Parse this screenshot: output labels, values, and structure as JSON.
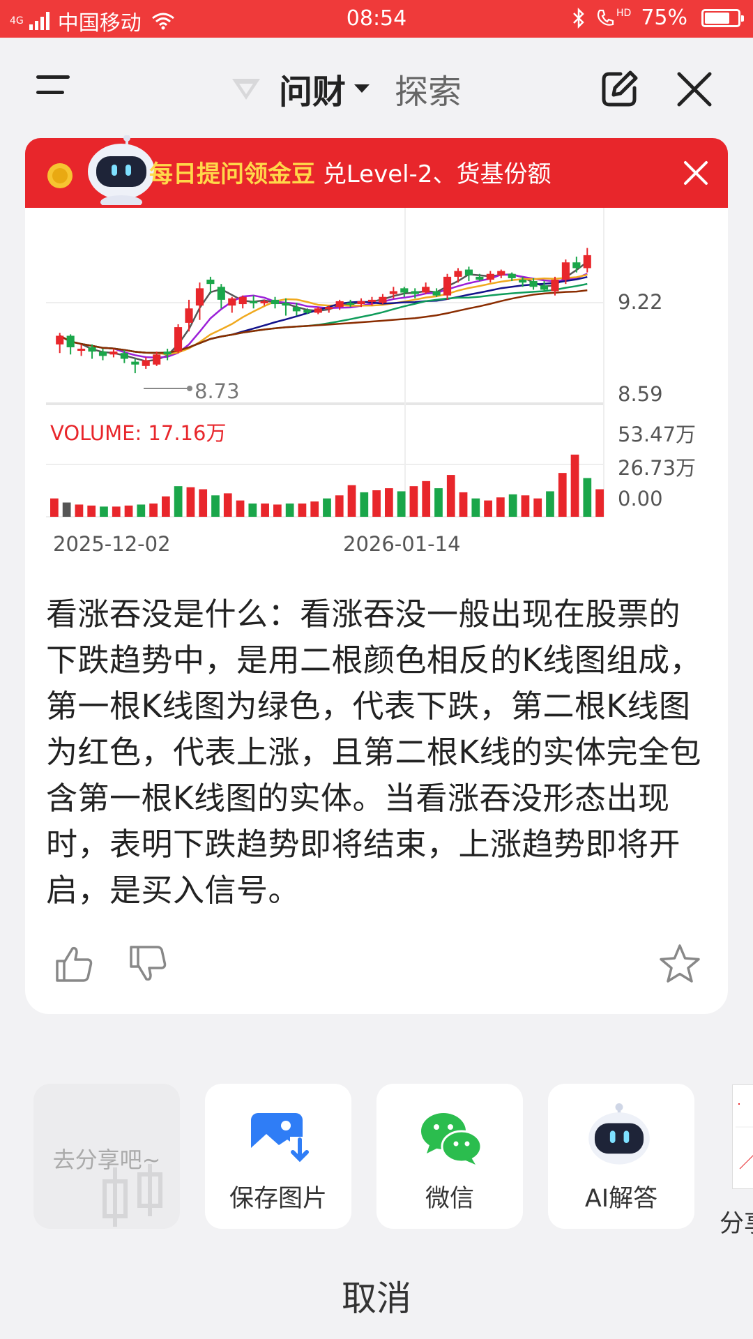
{
  "status_bar": {
    "network": "4G",
    "carrier": "中国移动",
    "time": "08:54",
    "battery": "75%",
    "battery_level": 0.75,
    "hd": "HD"
  },
  "header": {
    "active_tab": "问财",
    "other_tab": "探索"
  },
  "banner": {
    "highlight": "每日提问领金豆",
    "text": "兑Level-2、货基份额"
  },
  "chart_data": {
    "type": "candlestick",
    "price_ticks": [
      "9.22",
      "8.59"
    ],
    "volume_ticks": [
      "53.47万",
      "26.73万",
      "0.00"
    ],
    "dates": [
      "2025-12-02",
      "2026-01-14"
    ],
    "volume_label": "VOLUME: 17.16万",
    "low_marker": "8.73",
    "colors": {
      "up": "#e8262b",
      "down": "#1aa64a"
    },
    "candles": [
      [
        8.93,
        8.99,
        8.87,
        9.01,
        "up"
      ],
      [
        8.99,
        8.91,
        8.86,
        9.0,
        "down"
      ],
      [
        8.9,
        8.9,
        8.85,
        8.93,
        "up"
      ],
      [
        8.91,
        8.88,
        8.83,
        8.93,
        "down"
      ],
      [
        8.88,
        8.85,
        8.82,
        8.9,
        "down"
      ],
      [
        8.86,
        8.88,
        8.84,
        8.9,
        "up"
      ],
      [
        8.87,
        8.83,
        8.8,
        8.89,
        "down"
      ],
      [
        8.81,
        8.79,
        8.73,
        8.83,
        "down"
      ],
      [
        8.78,
        8.82,
        8.76,
        8.84,
        "up"
      ],
      [
        8.79,
        8.86,
        8.78,
        8.88,
        "up"
      ],
      [
        8.86,
        8.88,
        8.82,
        8.9,
        "down"
      ],
      [
        8.88,
        9.05,
        8.87,
        9.07,
        "up"
      ],
      [
        9.08,
        9.18,
        9.02,
        9.24,
        "up"
      ],
      [
        9.2,
        9.32,
        9.1,
        9.36,
        "up"
      ],
      [
        9.35,
        9.38,
        9.28,
        9.4,
        "down"
      ],
      [
        9.33,
        9.24,
        9.18,
        9.35,
        "down"
      ],
      [
        9.25,
        9.2,
        9.15,
        9.26,
        "up"
      ],
      [
        9.21,
        9.26,
        9.18,
        9.27,
        "up"
      ],
      [
        9.23,
        9.22,
        9.18,
        9.27,
        "down"
      ],
      [
        9.22,
        9.23,
        9.2,
        9.24,
        "up"
      ],
      [
        9.24,
        9.21,
        9.18,
        9.26,
        "down"
      ],
      [
        9.22,
        9.2,
        9.13,
        9.25,
        "down"
      ],
      [
        9.19,
        9.16,
        9.13,
        9.22,
        "down"
      ],
      [
        9.17,
        9.15,
        9.14,
        9.18,
        "down"
      ],
      [
        9.15,
        9.18,
        9.14,
        9.19,
        "up"
      ],
      [
        9.18,
        9.19,
        9.15,
        9.2,
        "up"
      ],
      [
        9.19,
        9.23,
        9.17,
        9.24,
        "up"
      ],
      [
        9.22,
        9.21,
        9.19,
        9.24,
        "down"
      ],
      [
        9.21,
        9.23,
        9.19,
        9.25,
        "up"
      ],
      [
        9.23,
        9.24,
        9.2,
        9.26,
        "up"
      ],
      [
        9.22,
        9.26,
        9.21,
        9.28,
        "up"
      ],
      [
        9.28,
        9.3,
        9.25,
        9.33,
        "up"
      ],
      [
        9.32,
        9.29,
        9.26,
        9.33,
        "down"
      ],
      [
        9.3,
        9.28,
        9.25,
        9.32,
        "down"
      ],
      [
        9.29,
        9.33,
        9.28,
        9.36,
        "up"
      ],
      [
        9.3,
        9.27,
        9.26,
        9.32,
        "down"
      ],
      [
        9.27,
        9.4,
        9.24,
        9.42,
        "up"
      ],
      [
        9.4,
        9.44,
        9.36,
        9.46,
        "up"
      ],
      [
        9.45,
        9.41,
        9.37,
        9.47,
        "down"
      ],
      [
        9.4,
        9.38,
        9.37,
        9.42,
        "down"
      ],
      [
        9.38,
        9.42,
        9.36,
        9.44,
        "up"
      ],
      [
        9.41,
        9.44,
        9.39,
        9.45,
        "up"
      ],
      [
        9.42,
        9.39,
        9.37,
        9.43,
        "down"
      ],
      [
        9.38,
        9.36,
        9.33,
        9.4,
        "down"
      ],
      [
        9.37,
        9.33,
        9.31,
        9.39,
        "down"
      ],
      [
        9.34,
        9.31,
        9.3,
        9.37,
        "down"
      ],
      [
        9.3,
        9.38,
        9.27,
        9.4,
        "up"
      ],
      [
        9.38,
        9.5,
        9.35,
        9.52,
        "up"
      ],
      [
        9.5,
        9.46,
        9.43,
        9.54,
        "down"
      ],
      [
        9.46,
        9.55,
        9.43,
        9.6,
        "up"
      ]
    ],
    "volumes": [
      18,
      14,
      12,
      11,
      10,
      10,
      11,
      12,
      13,
      20,
      30,
      29,
      27,
      21,
      23,
      16,
      13,
      13,
      12,
      13,
      13,
      15,
      18,
      21,
      31,
      24,
      26,
      28,
      25,
      30,
      35,
      28,
      41,
      24,
      18,
      16,
      19,
      22,
      21,
      18,
      25,
      43,
      61,
      38,
      27
    ]
  },
  "description": "看涨吞没是什么：看涨吞没一般出现在股票的下跌趋势中，是用二根颜色相反的K线图组成，第一根K线图为绿色，代表下跌，第二根K线图为红色，代表上涨，且第二根K线的实体完全包含第一根K线图的实体。当看涨吞没形态出现时，表明下跌趋势即将结束，上涨趋势即将开启，是买入信号。",
  "share": {
    "tiles": [
      {
        "label": "去分享吧~",
        "icon": "share-placeholder-icon"
      },
      {
        "label": "保存图片",
        "icon": "save-image-icon"
      },
      {
        "label": "微信",
        "icon": "wechat-icon"
      },
      {
        "label": "AI解答",
        "icon": "robot-icon"
      }
    ],
    "preview_label": "分享",
    "cancel": "取消"
  }
}
